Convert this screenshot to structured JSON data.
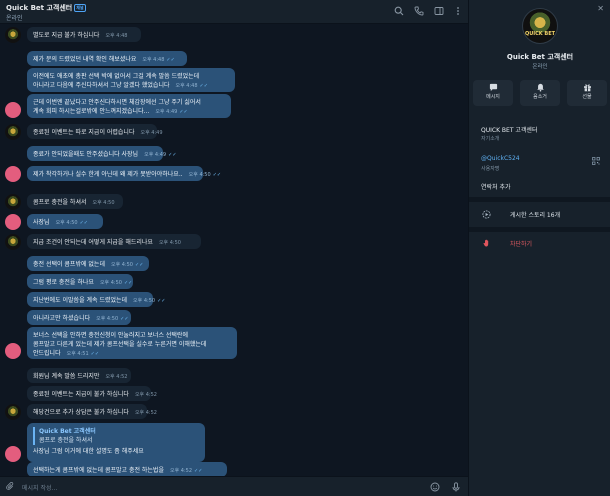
{
  "header": {
    "title": "Quick Bet 고객센터",
    "badge": "채널",
    "status": "온라인",
    "icons": [
      "search-icon",
      "phone-icon",
      "sidebar-icon",
      "more-icon"
    ]
  },
  "messages": [
    {
      "side": "in",
      "text": "별도로 지급 불가 하십니다",
      "time": "오후 4:48",
      "avatar": "brand"
    },
    {
      "side": "out",
      "text": "제가 문의 드렸었던 내역 확인 해보셨나요",
      "time": "오후 4:48"
    },
    {
      "side": "out",
      "lines": [
        "이전에도 애초에 총판 선택 박에 없어서 그걸 계속 말씀 드렸었는데",
        "아니라고 다음에 주신다하셔서 그냥 알겠다 했었습니다"
      ],
      "time": "오후 4:48"
    },
    {
      "side": "out",
      "lines": [
        "근데 이번엔 끝났다고 안주신다하시면 체감장에선 그냥 주기 싫어서",
        "계속 회피 하시는걸로밖에 안느껴지겠습니다..."
      ],
      "time": "오후 4:49",
      "avatar": "pink"
    },
    {
      "side": "in",
      "text": "종료된 이벤트는 따로 지급이 어렵습니다",
      "time": "오후 4:49",
      "avatar": "brand"
    },
    {
      "side": "out",
      "text": "종료가 안되었을때도 안주셨습니다 사장님",
      "time": "오후 4:49"
    },
    {
      "side": "out",
      "text": "제가 착각하거나 실수 한게 아닌데 왜 제가 못받아야하나요..",
      "time": "오후 4:50",
      "avatar": "pink"
    },
    {
      "side": "in",
      "text": "콤프로 충전을 하셔서",
      "time": "오후 4:50",
      "avatar": "brand"
    },
    {
      "side": "out",
      "text": "사장님",
      "time": "오후 4:50",
      "avatar": "pink"
    },
    {
      "side": "in",
      "text": "지급 조건이 안되는데 어떻게 지급을 해드리나요",
      "time": "오후 4:50",
      "avatar": "brand"
    },
    {
      "side": "out",
      "text": "충전 선택이 콤프밖에 없는데",
      "time": "오후 4:50"
    },
    {
      "side": "out",
      "text": "그럼 평로 충전을 하나요",
      "time": "오후 4:50"
    },
    {
      "side": "out",
      "text": "지난번에도 이말씀을 계속 드렸었는데",
      "time": "오후 4:50"
    },
    {
      "side": "out",
      "text": "아니라고만 하셨습니다",
      "time": "오후 4:50"
    },
    {
      "side": "out",
      "lines": [
        "보너스 선택을 안하면 충전신청이 안눌러지고 보너스 선택란에",
        "콤프말고 다른게 있는데 제가 콤프선택을 실수로 누른거면 이해했는데",
        "안드립니다"
      ],
      "time": "오후 4:51",
      "avatar": "pink"
    },
    {
      "side": "in",
      "text": "회원님 계속 말씀 드리지만",
      "time": "오후 4:52"
    },
    {
      "side": "in",
      "text": "종료된 이벤트는 지급이 불가 하십니다",
      "time": "오후 4:52"
    },
    {
      "side": "in",
      "text": "해당건으로 추가 상담은 불가 하십니다",
      "time": "오후 4:52",
      "avatar": "brand"
    },
    {
      "side": "out",
      "quote": {
        "title": "Quick Bet 고객센터",
        "text": "콤프로 충전을 하셔서"
      },
      "text": "사장님 그럼 이거에 대한 설명도 좀 해주세요",
      "time": "",
      "avatar": "pink"
    },
    {
      "side": "out",
      "text": "선택하는게 콤프밖에 없는데 콤프말고 충전 하는법을",
      "time": "오후 4:52"
    }
  ],
  "composer": {
    "placeholder": "메시지 작성..."
  },
  "profile": {
    "avatar_text": "QUICK BET",
    "name": "Quick Bet 고객센터",
    "status": "온라인",
    "actions": [
      {
        "label": "메시지",
        "icon": "message-icon"
      },
      {
        "label": "음소거",
        "icon": "bell-icon"
      },
      {
        "label": "선물",
        "icon": "gift-icon"
      }
    ],
    "about_title": "QUICK BET 고객센터",
    "about_sub": "자기소개",
    "username": "@QuickC524",
    "username_sub": "사용자명",
    "add_contact": "연락처 추가",
    "stories": "게시한 스토리 16개",
    "block": "차단하기"
  }
}
